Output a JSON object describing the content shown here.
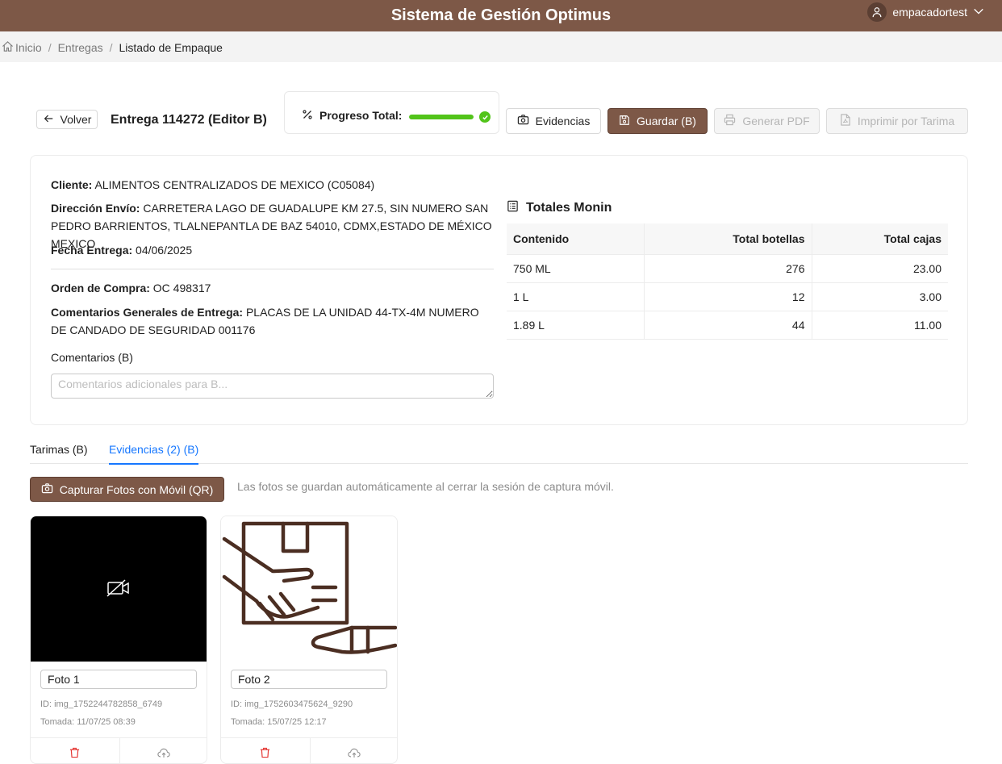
{
  "app": {
    "title": "Sistema de Gestión Optimus",
    "user": "empacadortest"
  },
  "breadcrumb": {
    "home": "Inicio",
    "section": "Entregas",
    "current": "Listado de Empaque",
    "separator": "/"
  },
  "header": {
    "back_label": "Volver",
    "title": "Entrega 114272 (Editor B)",
    "progress_label": "Progreso Total:",
    "progress_value": 1.0,
    "buttons": {
      "evidencias": "Evidencias",
      "guardar": "Guardar (B)",
      "generar_pdf": "Generar PDF",
      "imprimir": "Imprimir por Tarima"
    }
  },
  "info": {
    "cliente_label": "Cliente:",
    "cliente": "ALIMENTOS CENTRALIZADOS DE MEXICO (C05084)",
    "direccion_label": "Dirección Envío:",
    "direccion": "CARRETERA LAGO DE GUADALUPE KM 27.5, SIN NUMERO SAN PEDRO BARRIENTOS, TLALNEPANTLA DE BAZ 54010, CDMX,ESTADO DE MÉXICO MEXICO",
    "fecha_label": "Fecha Entrega:",
    "fecha": "04/06/2025",
    "orden_label": "Orden de Compra:",
    "orden": "OC 498317",
    "comentarios_generales_label": "Comentarios Generales de Entrega:",
    "comentarios_generales": "PLACAS DE LA UNIDAD 44-TX-4M NUMERO DE CANDADO DE SEGURIDAD 001176",
    "comentarios_label": "Comentarios (B)",
    "comentarios_placeholder": "Comentarios adicionales para B..."
  },
  "totals": {
    "title": "Totales Monin",
    "headers": [
      "Contenido",
      "Total botellas",
      "Total cajas"
    ],
    "rows": [
      [
        "750 ML",
        "276",
        "23.00"
      ],
      [
        "1 L",
        "12",
        "3.00"
      ],
      [
        "1.89 L",
        "44",
        "11.00"
      ]
    ]
  },
  "tabs": [
    {
      "label": "Tarimas (B)"
    },
    {
      "label": "Evidencias (2) (B)"
    }
  ],
  "evidencias": {
    "capture_button": "Capturar Fotos con Móvil (QR)",
    "hint": "Las fotos se guardan automáticamente al cerrar la sesión de captura móvil.",
    "photos": [
      {
        "name": "Foto 1",
        "id": "ID: img_1752244782858_6749",
        "taken": "Tomada: 11/07/25 08:39"
      },
      {
        "name": "Foto 2",
        "id": "ID: img_1752603475624_9290",
        "taken": "Tomada: 15/07/25 12:17"
      }
    ]
  },
  "colors": {
    "brand": "#7d5847",
    "accent": "#1677ff",
    "success": "#52c41a",
    "danger": "#e53935"
  }
}
